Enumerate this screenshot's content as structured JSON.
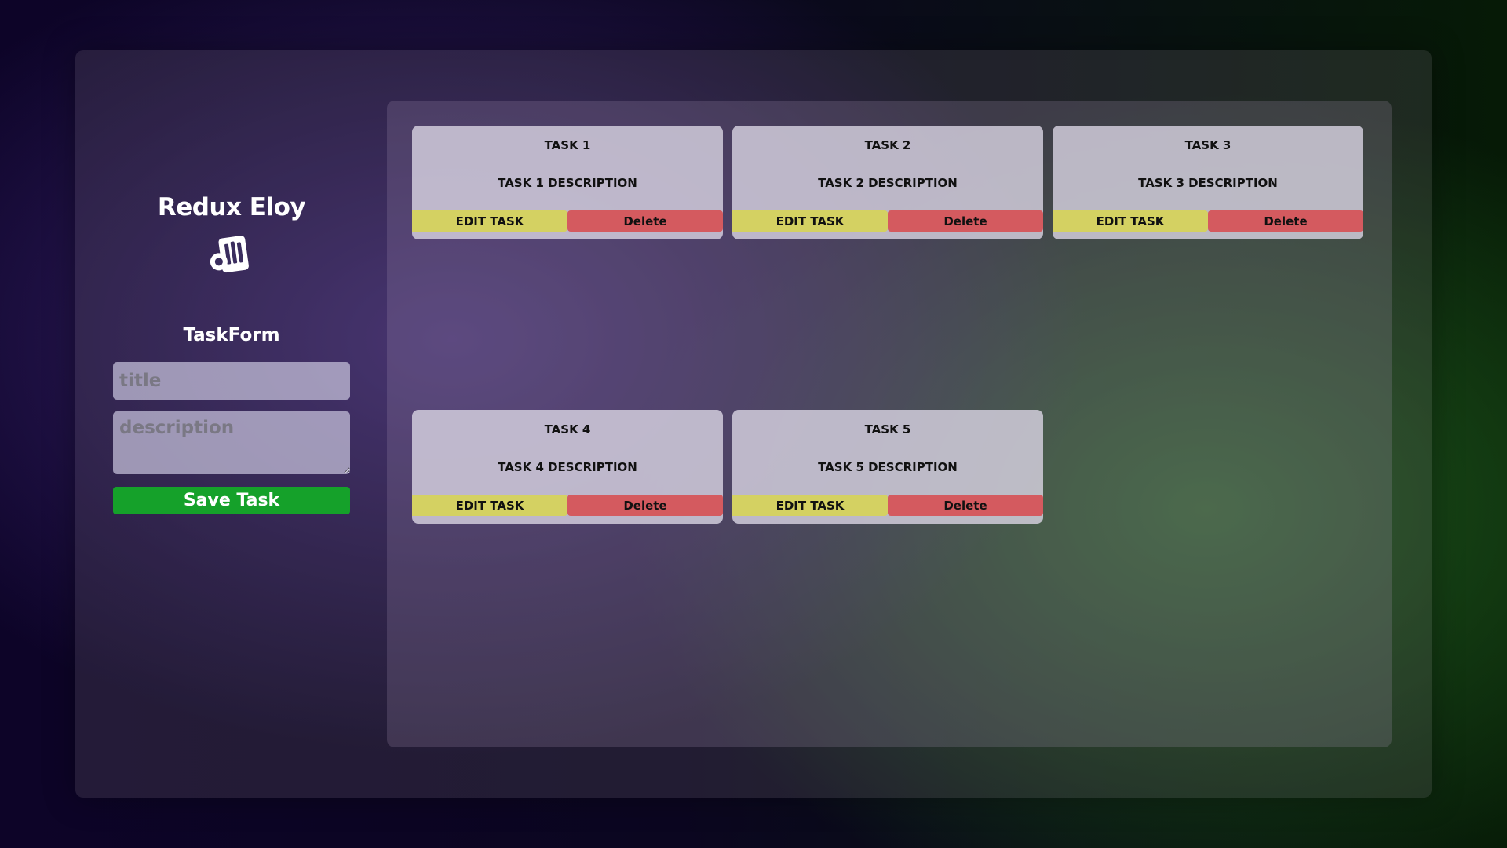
{
  "app": {
    "brand": "Redux Eloy",
    "logo_icon": "redux-logo-icon"
  },
  "form": {
    "title": "TaskForm",
    "title_placeholder": "title",
    "description_placeholder": "description",
    "save_label": "Save Task"
  },
  "tasks": [
    {
      "title": "TASK 1",
      "description": "TASK 1 DESCRIPTION",
      "edit_label": "EDIT TASK",
      "delete_label": "Delete"
    },
    {
      "title": "TASK 2",
      "description": "TASK 2 DESCRIPTION",
      "edit_label": "EDIT TASK",
      "delete_label": "Delete"
    },
    {
      "title": "TASK 3",
      "description": "TASK 3 DESCRIPTION",
      "edit_label": "EDIT TASK",
      "delete_label": "Delete"
    },
    {
      "title": "TASK 4",
      "description": "TASK 4 DESCRIPTION",
      "edit_label": "EDIT TASK",
      "delete_label": "Delete"
    },
    {
      "title": "TASK 5",
      "description": "TASK 5 DESCRIPTION",
      "edit_label": "EDIT TASK",
      "delete_label": "Delete"
    }
  ],
  "colors": {
    "save_button": "#15a12a",
    "edit_button": "#d4d162",
    "delete_button": "#d45a5f"
  }
}
